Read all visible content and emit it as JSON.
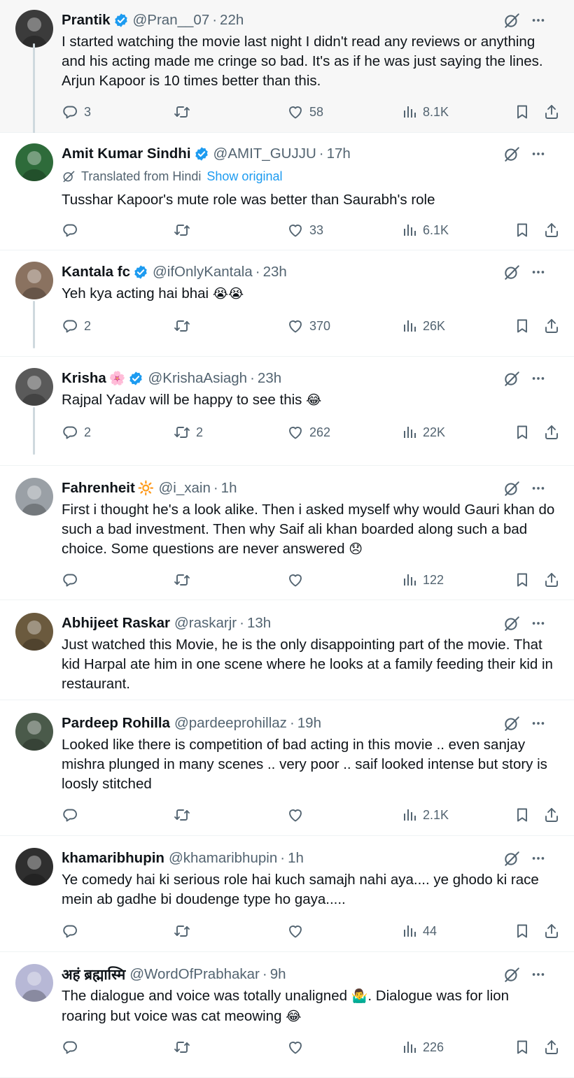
{
  "tweets": [
    {
      "name": "Prantik",
      "name_emoji": "",
      "handle": "@Pran__07",
      "time": "22h",
      "verified": true,
      "text": "I started watching the movie last night I didn't read any reviews or anything and his acting made me cringe so bad. It's as if he was just saying the lines. Arjun Kapoor is 10 times better than this.",
      "replies": "3",
      "retweets": "",
      "likes": "58",
      "views": "8.1K",
      "avatar_color": "#3b3b3b"
    },
    {
      "name": "Amit Kumar Sindhi",
      "name_emoji": "",
      "handle": "@AMIT_GUJJU",
      "time": "17h",
      "verified": true,
      "translated_label": "Translated from Hindi",
      "show_original": "Show original",
      "text": "Tusshar Kapoor's mute role was better than Saurabh's role",
      "replies": "",
      "retweets": "",
      "likes": "33",
      "views": "6.1K",
      "avatar_color": "#2e6b3a"
    },
    {
      "name": "Kantala fc",
      "name_emoji": "",
      "handle": "@ifOnlyKantala",
      "time": "23h",
      "verified": true,
      "text": "Yeh kya acting hai bhai",
      "text_emoji": "😭😭",
      "replies": "2",
      "retweets": "",
      "likes": "370",
      "views": "26K",
      "avatar_color": "#8a7260"
    },
    {
      "name": "Krisha",
      "name_emoji": "🌸",
      "handle": "@KrishaAsiagh",
      "time": "23h",
      "verified": true,
      "text": "Rajpal Yadav will be happy to see this",
      "text_emoji": "😂",
      "replies": "2",
      "retweets": "2",
      "likes": "262",
      "views": "22K",
      "avatar_color": "#5a5a5a"
    },
    {
      "name": "Fahrenheit",
      "name_emoji": "🔆",
      "handle": "@i_xain",
      "time": "1h",
      "verified": false,
      "text": "First i thought he's a look alike. Then i asked myself why would Gauri khan do such a bad investment. Then why Saif ali khan boarded along such a bad choice. Some questions are never answered",
      "text_emoji": "😞",
      "replies": "",
      "retweets": "",
      "likes": "",
      "views": "122",
      "avatar_color": "#9aa0a6"
    },
    {
      "name": "Abhijeet Raskar",
      "name_emoji": "",
      "handle": "@raskarjr",
      "time": "13h",
      "verified": false,
      "text": "Just watched this Movie, he is the only disappointing part of the movie. That kid Harpal ate him in one scene where he looks at a family feeding their kid in restaurant.",
      "avatar_color": "#6b5a3e"
    },
    {
      "name": "Pardeep Rohilla",
      "name_emoji": "",
      "handle": "@pardeeprohillaz",
      "time": "19h",
      "verified": false,
      "text": "Looked like there is competition of bad acting in this movie .. even sanjay mishra plunged in many scenes .. very poor .. saif looked intense but story is loosly stitched",
      "replies": "",
      "retweets": "",
      "likes": "",
      "views": "2.1K",
      "avatar_color": "#4a5a4a"
    },
    {
      "name": "khamaribhupin",
      "name_emoji": "",
      "handle": "@khamaribhupin",
      "time": "1h",
      "verified": false,
      "text": "Ye comedy hai ki serious role hai kuch samajh nahi aya.... ye ghodo ki race mein ab gadhe bi doudenge type ho gaya.....",
      "replies": "",
      "retweets": "",
      "likes": "",
      "views": "44",
      "avatar_color": "#2f2f2f"
    },
    {
      "name": "अहं ब्रह्मास्मि",
      "name_emoji": "",
      "handle": "@WordOfPrabhakar",
      "time": "9h",
      "verified": false,
      "text": "The dialogue and voice was totally unaligned",
      "text_emoji": "🤷‍♂️",
      "text_rest": ". Dialogue was for lion roaring but voice was cat meowing",
      "text_emoji2": "😂",
      "replies": "",
      "retweets": "",
      "likes": "",
      "views": "226",
      "avatar_color": "#b7b8d6"
    }
  ],
  "colors": {
    "text": "#0f1419",
    "secondary": "#536471",
    "verified": "#1d9bf0",
    "link": "#1d9bf0",
    "highlight_bg": "#f7f7f7",
    "divider": "#eff3f4"
  },
  "icons": {
    "reply": "reply-icon",
    "retweet": "retweet-icon",
    "like": "heart-icon",
    "views": "views-icon",
    "bookmark": "bookmark-icon",
    "share": "share-icon",
    "grok": "grok-icon",
    "more": "more-icon",
    "verified": "verified-badge-icon"
  }
}
